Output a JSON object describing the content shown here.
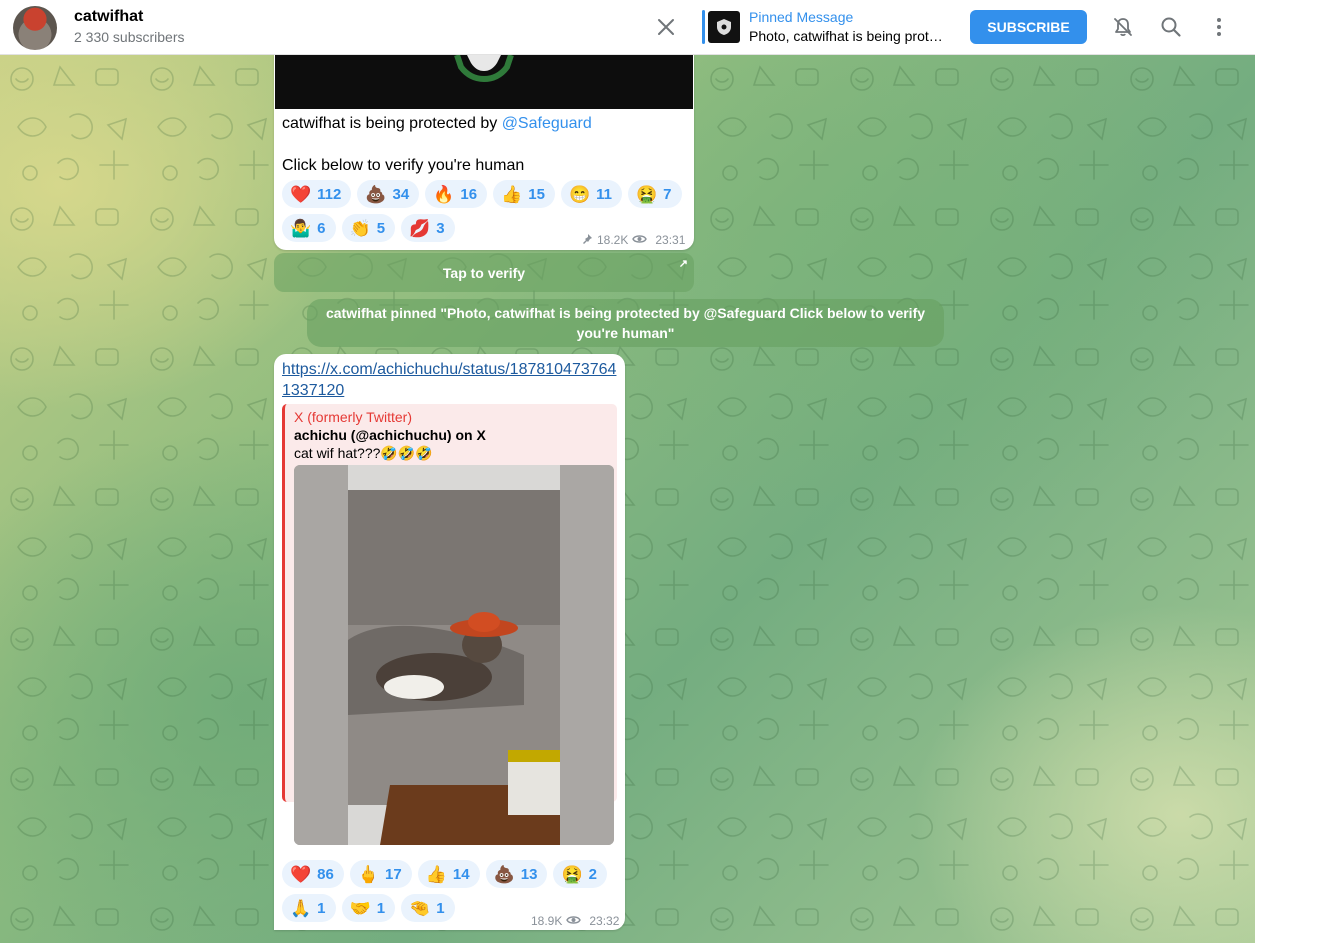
{
  "header": {
    "channel_title": "catwifhat",
    "subscribers": "2 330 subscribers",
    "pinned_label": "Pinned Message",
    "pinned_text": "Photo, catwifhat is being protected by @Safeguard Click below to verify you're human",
    "subscribe_label": "SUBSCRIBE",
    "icons": [
      "close-icon",
      "mute-bell-icon",
      "search-icon",
      "more-vertical-icon"
    ]
  },
  "messages": [
    {
      "text_before_mention": "catwifhat is being protected by ",
      "mention": "@Safeguard",
      "text_line2": "Click below to verify you're human",
      "reactions": [
        {
          "emoji": "❤️",
          "count": "112"
        },
        {
          "emoji": "💩",
          "count": "34"
        },
        {
          "emoji": "🔥",
          "count": "16"
        },
        {
          "emoji": "👍",
          "count": "15"
        },
        {
          "emoji": "😁",
          "count": "11"
        },
        {
          "emoji": "🤮",
          "count": "7"
        },
        {
          "emoji": "🤷‍♂️",
          "count": "6"
        },
        {
          "emoji": "👏",
          "count": "5"
        },
        {
          "emoji": "💋",
          "count": "3"
        }
      ],
      "pinned": true,
      "views": "18.2K",
      "time": "23:31",
      "button_label": "Tap to verify"
    },
    {
      "link": "https://x.com/achichuchu/status/1878104737641337120",
      "preview_site": "X (formerly Twitter)",
      "preview_title": "achichu (@achichuchu) on X",
      "preview_desc": "cat wif hat???🤣🤣🤣",
      "reactions": [
        {
          "emoji": "❤️",
          "count": "86"
        },
        {
          "emoji": "🖕",
          "count": "17"
        },
        {
          "emoji": "👍",
          "count": "14"
        },
        {
          "emoji": "💩",
          "count": "13"
        },
        {
          "emoji": "🤮",
          "count": "2"
        },
        {
          "emoji": "🙏",
          "count": "1"
        },
        {
          "emoji": "🤝",
          "count": "1"
        },
        {
          "emoji": "🤏",
          "count": "1"
        }
      ],
      "views": "18.9K",
      "time": "23:32"
    }
  ],
  "service_message": {
    "actor": "catwifhat",
    "text": " pinned \"Photo, catwifhat is being protected by @Safeguard Click below to verify you're human\""
  },
  "colors": {
    "accent": "#3390ec",
    "reaction_bg": "#eaf3fd",
    "preview_accent": "#e53935"
  }
}
